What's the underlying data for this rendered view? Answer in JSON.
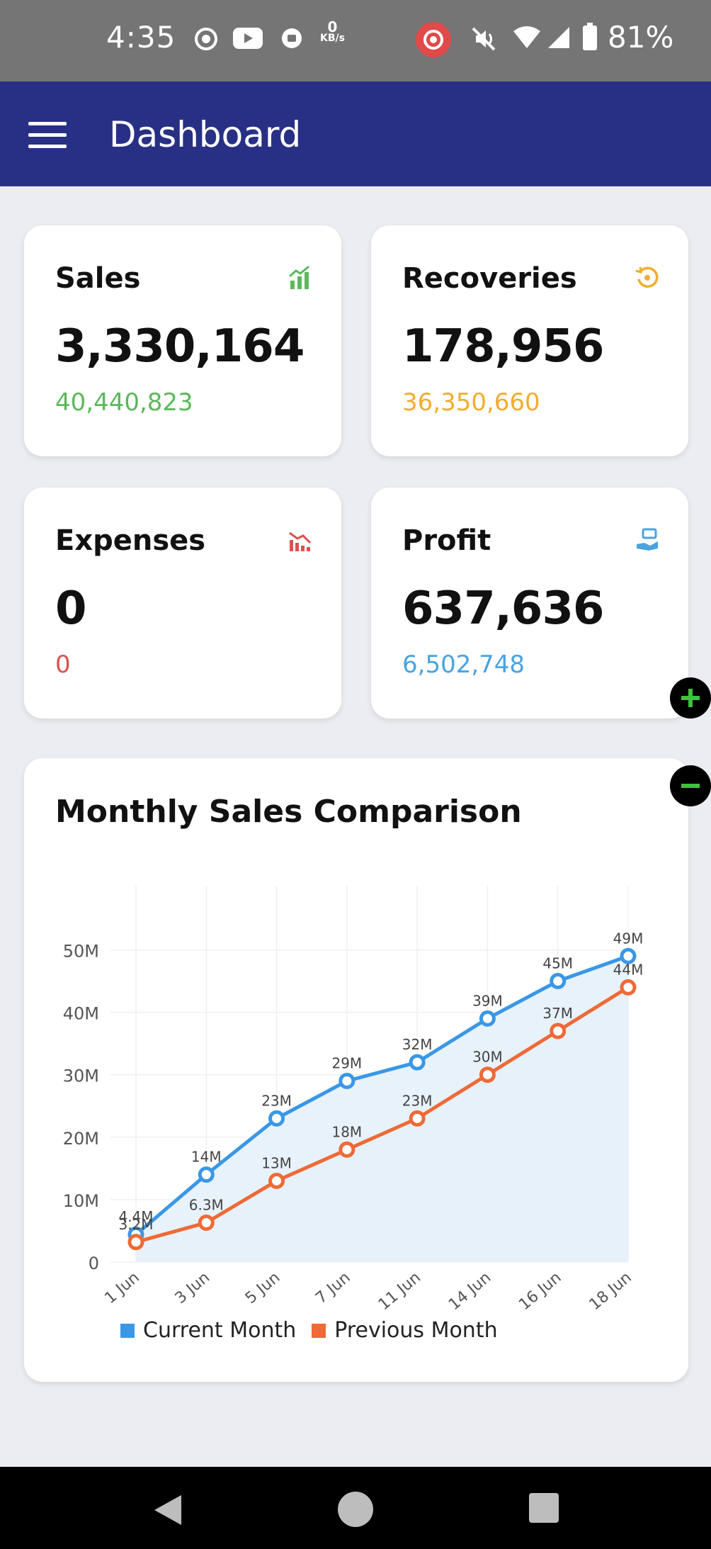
{
  "status_bar": {
    "time": "4:35",
    "net_speed_value": "0",
    "net_speed_unit": "KB/s",
    "battery": "81%",
    "icons": [
      "record-icon",
      "youtube-icon",
      "app-icon",
      "cast-icon",
      "mute-icon",
      "wifi-icon",
      "signal-icon",
      "battery-icon"
    ]
  },
  "app_bar": {
    "title": "Dashboard",
    "menu_icon": "hamburger-menu-icon"
  },
  "cards": {
    "sales": {
      "title": "Sales",
      "value": "3,330,164",
      "sub": "40,440,823",
      "color": "#5cb85c",
      "icon": "bar-chart-icon"
    },
    "recoveries": {
      "title": "Recoveries",
      "value": "178,956",
      "sub": "36,350,660",
      "color": "#f0ad2e",
      "icon": "refresh-icon"
    },
    "expenses": {
      "title": "Expenses",
      "value": "0",
      "sub": "0",
      "color": "#d9534f",
      "icon": "trend-down-icon"
    },
    "profit": {
      "title": "Profit",
      "value": "637,636",
      "sub": "6,502,748",
      "color": "#4aa3df",
      "icon": "hand-money-icon"
    }
  },
  "fabs": {
    "zoom_in": "plus-icon",
    "zoom_out": "minus-icon"
  },
  "chart": {
    "title": "Monthly Sales Comparison"
  },
  "chart_data": {
    "type": "area",
    "title": "Monthly Sales Comparison",
    "categories": [
      "1 Jun",
      "3 Jun",
      "5 Jun",
      "7 Jun",
      "11 Jun",
      "14 Jun",
      "16 Jun",
      "18 Jun"
    ],
    "y_ticks": [
      "0",
      "10M",
      "20M",
      "30M",
      "40M",
      "50M"
    ],
    "ylim": [
      0,
      58
    ],
    "y_unit": "M",
    "grid": true,
    "legend_position": "bottom",
    "series": [
      {
        "name": "Current Month",
        "color": "#3a97e6",
        "fill": "#e6f1fb",
        "values": [
          4.4,
          14,
          23,
          29,
          32,
          39,
          45,
          49
        ],
        "labels": [
          "4.4M",
          "14M",
          "23M",
          "29M",
          "32M",
          "39M",
          "45M",
          "49M"
        ]
      },
      {
        "name": "Previous Month",
        "color": "#ee6a37",
        "fill": "#f4eef0",
        "values": [
          3.2,
          6.3,
          13,
          18,
          23,
          30,
          37,
          44
        ],
        "labels": [
          "3.2M",
          "6.3M",
          "13M",
          "18M",
          "23M",
          "30M",
          "37M",
          "44M"
        ]
      }
    ]
  },
  "nav_bar": {
    "back": "back-icon",
    "home": "home-icon",
    "recents": "recents-icon"
  }
}
